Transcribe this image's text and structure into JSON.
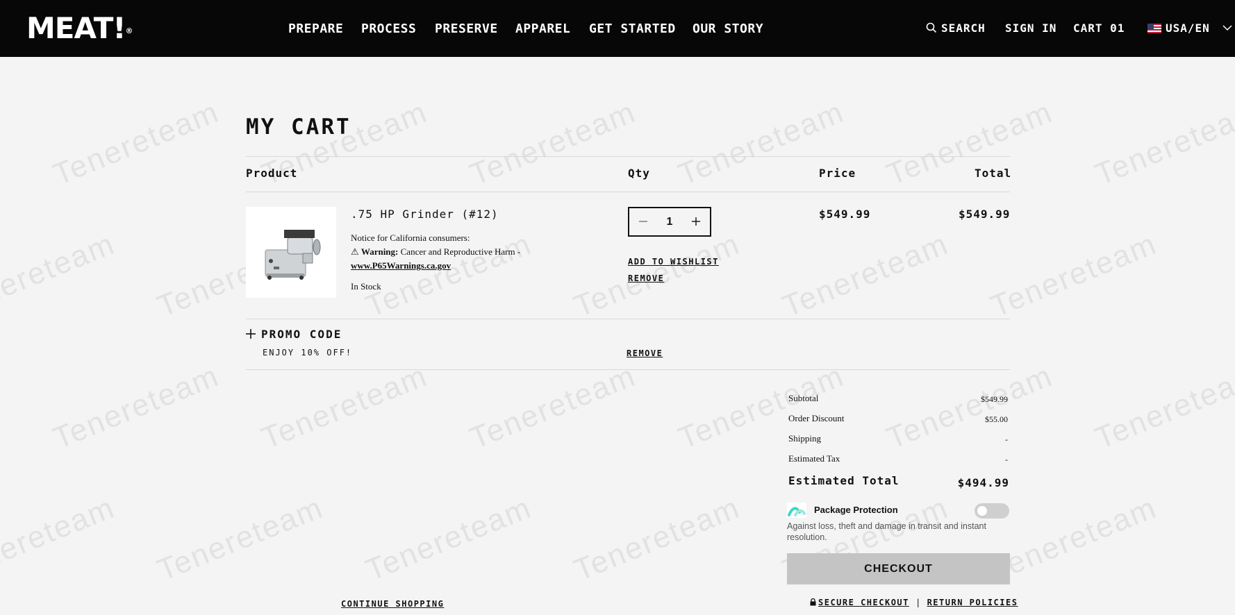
{
  "header": {
    "logo": "MEAT!",
    "logo_mark": "®",
    "nav": [
      "PREPARE",
      "PROCESS",
      "PRESERVE",
      "APPAREL",
      "GET STARTED",
      "OUR STORY"
    ],
    "search": "SEARCH",
    "sign_in": "SIGN IN",
    "cart": "CART 01",
    "locale": "USA/EN"
  },
  "watermark": "Tenereteam",
  "cart": {
    "title": "MY CART",
    "columns": {
      "product": "Product",
      "qty": "Qty",
      "price": "Price",
      "total": "Total"
    },
    "item": {
      "name": ".75 HP Grinder (#12)",
      "notice": "Notice for California consumers:",
      "warning_label": "Warning:",
      "warning_text": "Cancer and Reproductive Harm -",
      "warning_link": "www.P65Warnings.ca.gov",
      "stock": "In Stock",
      "qty": "1",
      "add_to_wishlist": "ADD TO WISHLIST",
      "remove": "REMOVE",
      "price": "$549.99",
      "total": "$549.99"
    },
    "promo": {
      "label": "PROMO CODE",
      "applied": "ENJOY 10% OFF!",
      "remove": "REMOVE"
    },
    "summary": {
      "subtotal_label": "Subtotal",
      "subtotal": "$549.99",
      "discount_label": "Order Discount",
      "discount": "$55.00",
      "shipping_label": "Shipping",
      "shipping": "-",
      "tax_label": "Estimated Tax",
      "tax": "-",
      "total_label": "Estimated Total",
      "total": "$494.99"
    },
    "protection": {
      "title": "Package Protection",
      "description": "Against loss, theft and damage in transit and instant resolution.",
      "enabled": false
    },
    "checkout": "CHECKOUT",
    "secure_checkout": "SECURE CHECKOUT",
    "separator": "|",
    "return_policies": "RETURN POLICIES",
    "continue_shopping": "CONTINUE SHOPPING"
  },
  "colors": {
    "header_bg": "#070707",
    "page_bg": "#f4f4f4",
    "checkout_bg": "#c4c4c4",
    "accent_teal": "#3fd6c6"
  }
}
